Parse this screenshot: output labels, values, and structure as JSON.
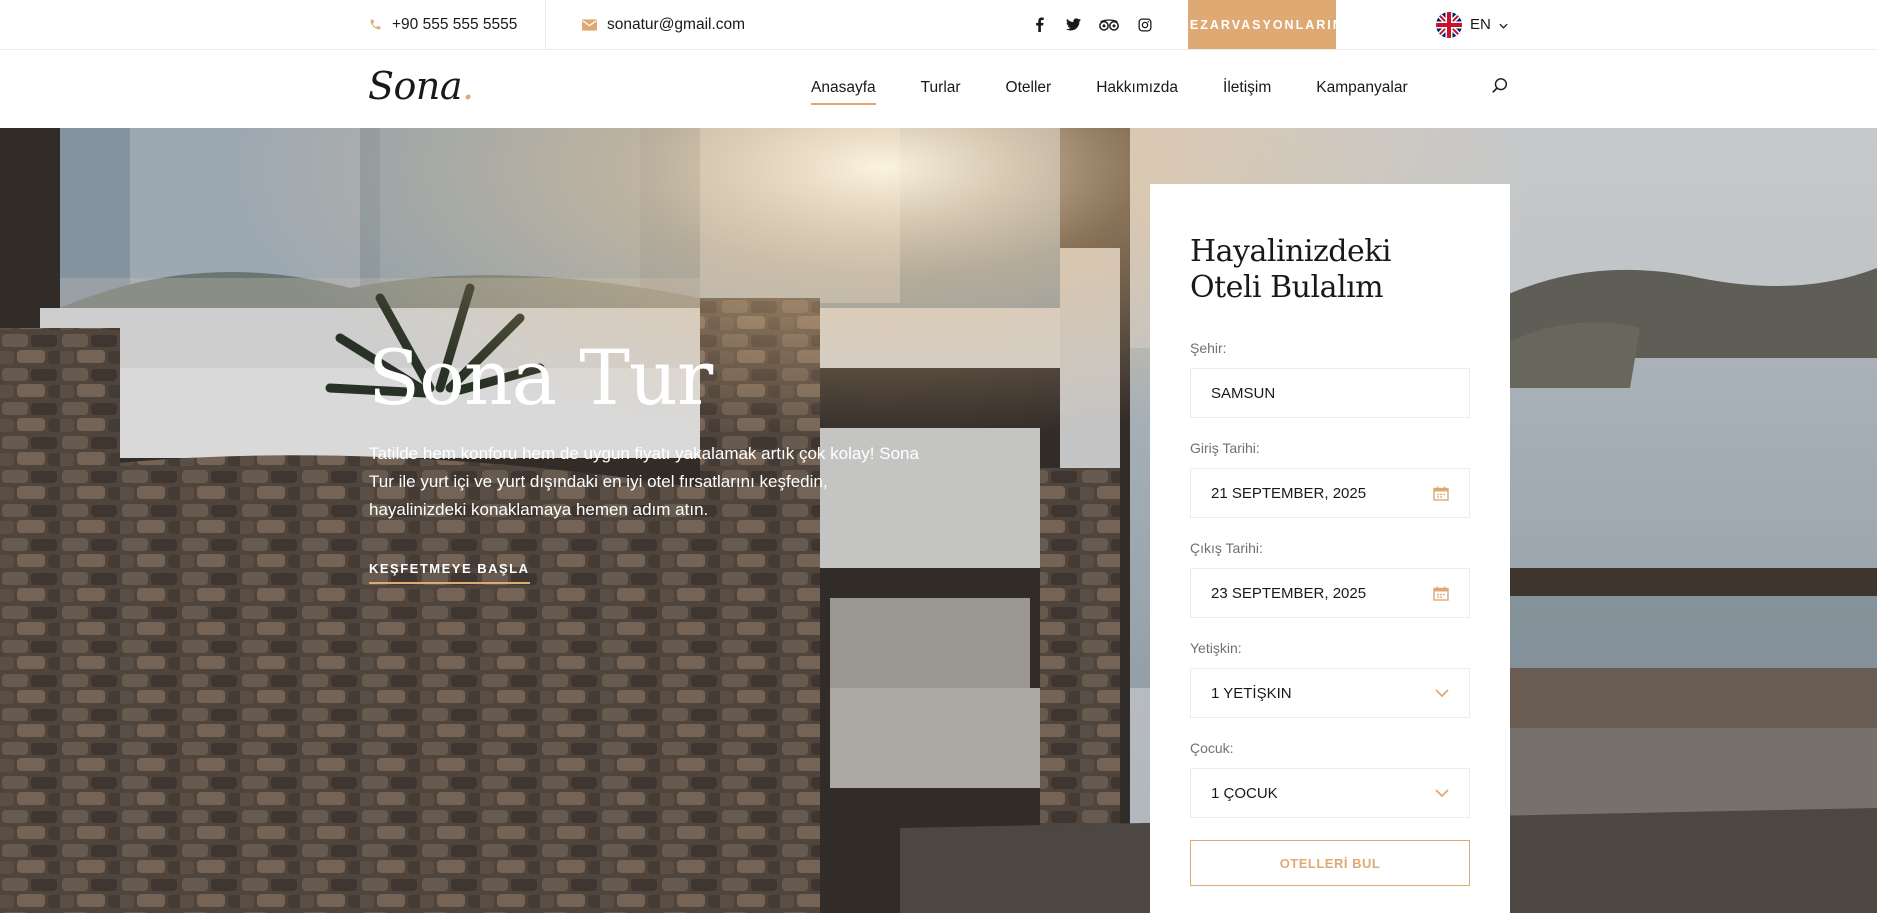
{
  "topbar": {
    "phone": "+90 555 555 5555",
    "email": "sonatur@gmail.com",
    "reserve_button": "REZARVASYONLARIM",
    "language": "EN"
  },
  "header": {
    "logo": "Sona",
    "logo_dot": ".",
    "nav": [
      {
        "label": "Anasayfa"
      },
      {
        "label": "Turlar"
      },
      {
        "label": "Oteller"
      },
      {
        "label": "Hakkımızda"
      },
      {
        "label": "İletişim"
      },
      {
        "label": "Kampanyalar"
      }
    ]
  },
  "hero": {
    "title": "Sona Tur",
    "text": "Tatilde hem konforu hem de uygun fiyatı yakalamak artık çok kolay! Sona Tur ile yurt içi ve yurt dışındaki en iyi otel fırsatlarını keşfedin, hayalinizdeki konaklamaya hemen adım atın.",
    "cta": "KEŞFETMEYE BAŞLA"
  },
  "booking": {
    "title": "Hayalinizdeki Oteli Bulalım",
    "city_label": "Şehir:",
    "city_value": "SAMSUN",
    "checkin_label": "Giriş Tarihi:",
    "checkin_value": "21 SEPTEMBER, 2025",
    "checkout_label": "Çıkış Tarihi:",
    "checkout_value": "23 SEPTEMBER, 2025",
    "adults_label": "Yetişkin:",
    "adults_value": "1 YETİŞKIN",
    "children_label": "Çocuk:",
    "children_value": "1 ÇOCUK",
    "submit": "OTELLERİ BUL"
  },
  "colors": {
    "accent": "#dfa974",
    "text": "#19191a",
    "muted": "#707079",
    "border": "#ebebeb"
  },
  "icons": [
    "phone-icon",
    "envelope-icon",
    "facebook-icon",
    "twitter-icon",
    "tripadvisor-icon",
    "instagram-icon",
    "uk-flag-icon",
    "chevron-down-icon",
    "search-icon",
    "calendar-icon"
  ]
}
